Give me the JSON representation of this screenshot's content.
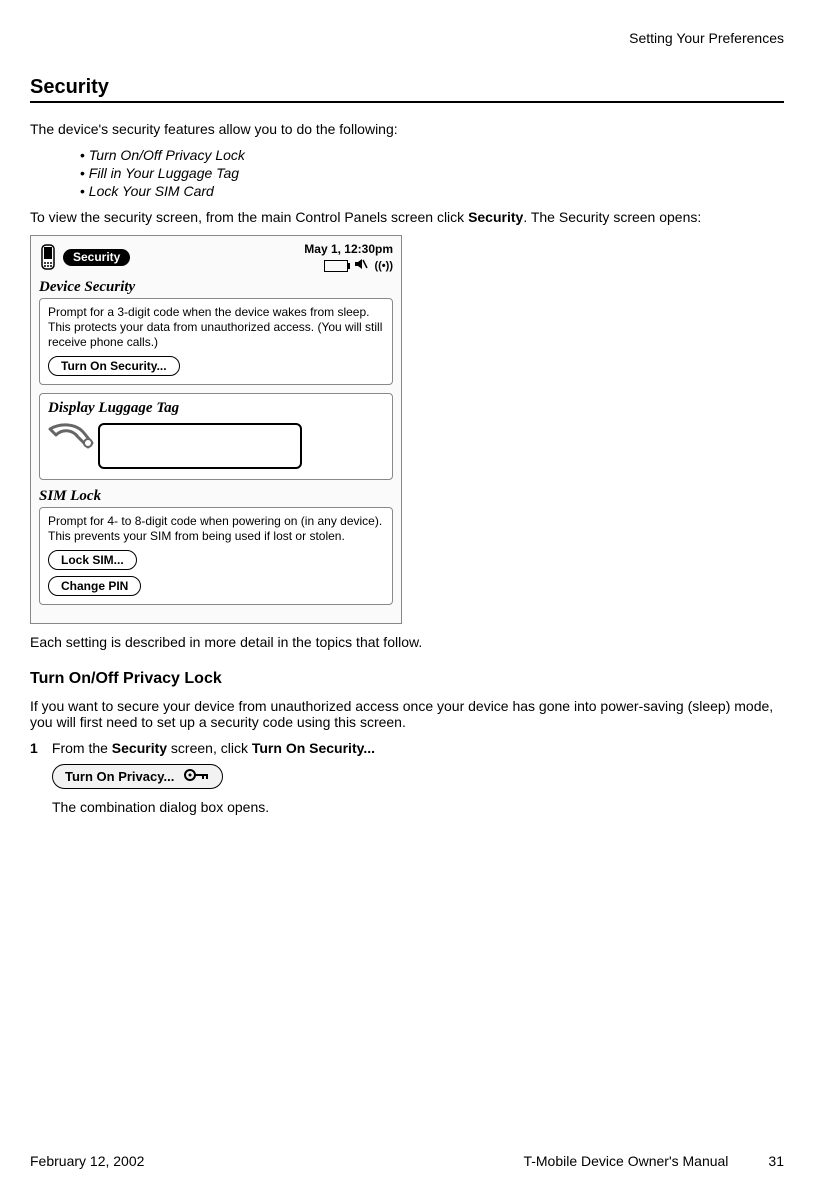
{
  "running_head": "Setting Your Preferences",
  "section_title": "Security",
  "intro": "The device's security features allow you to do the following:",
  "bullets": [
    "Turn On/Off Privacy Lock",
    "Fill in Your Luggage Tag",
    "Lock Your SIM Card"
  ],
  "view_instr_pre": "To view the security screen, from the main Control Panels screen click ",
  "view_instr_bold": "Security",
  "view_instr_post": ". The Security screen opens:",
  "screenshot": {
    "title": "Security",
    "time": "May 1, 12:30pm",
    "device_security": {
      "heading": "Device Security",
      "desc": "Prompt for a 3-digit code when the device wakes from sleep. This protects your data from unauthorized access. (You will still receive phone calls.)",
      "button": "Turn On Security..."
    },
    "luggage": {
      "heading": "Display Luggage Tag"
    },
    "sim_lock": {
      "heading": "SIM Lock",
      "desc": "Prompt for 4- to 8-digit code when powering on (in any device). This prevents your SIM from being used if lost or stolen.",
      "button_lock": "Lock SIM...",
      "button_pin": "Change PIN"
    }
  },
  "after_shot": "Each setting is described in more detail in the topics that follow.",
  "sub_heading": "Turn On/Off Privacy Lock",
  "sub_intro": "If you want to secure your device from unauthorized access once your device has gone into power-saving (sleep) mode, you will first need to set up a security code using this screen.",
  "step1": {
    "num": "1",
    "pre": "From the ",
    "bold1": "Security",
    "mid": " screen, click ",
    "bold2": "Turn On Security...",
    "inline_button": "Turn On Privacy...",
    "followup": "The combination dialog box opens."
  },
  "footer": {
    "date": "February 12, 2002",
    "manual": "T-Mobile Device Owner's Manual",
    "page": "31"
  }
}
